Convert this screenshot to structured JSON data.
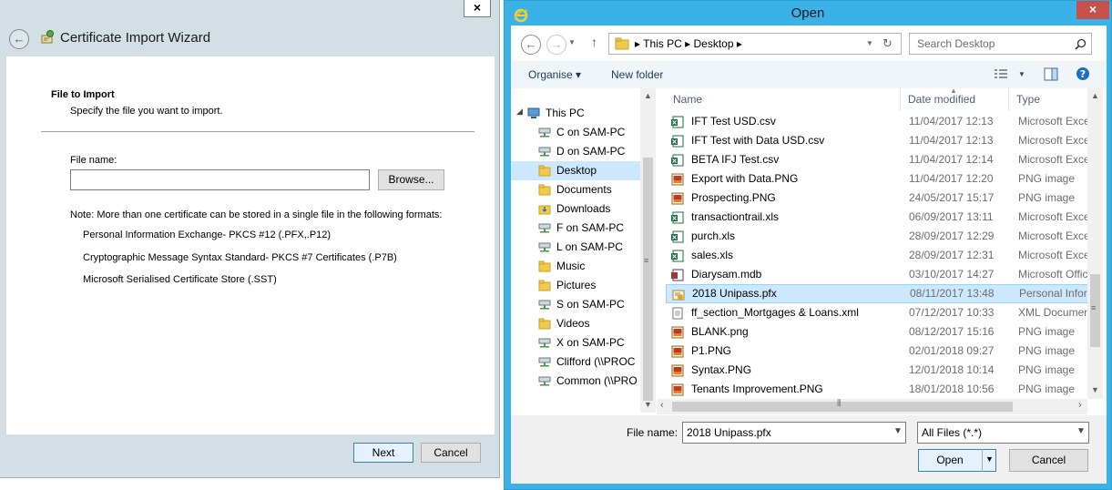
{
  "wizard": {
    "title": "Certificate Import Wizard",
    "close_glyph": "×",
    "back_glyph": "←",
    "heading": "File to Import",
    "subheading": "Specify the file you want to import.",
    "file_name_label": "File name:",
    "file_name_value": "",
    "browse_label": "Browse...",
    "note": "Note:  More than one certificate can be stored in a single file in the following formats:",
    "formats": [
      "Personal Information Exchange- PKCS #12 (.PFX,.P12)",
      "Cryptographic Message Syntax Standard- PKCS #7 Certificates (.P7B)",
      "Microsoft Serialised Certificate Store (.SST)"
    ],
    "next_label": "Next",
    "cancel_label": "Cancel"
  },
  "open": {
    "title": "Open",
    "close_glyph": "×",
    "address": "▸  This PC  ▸  Desktop  ▸",
    "search_placeholder": "Search Desktop",
    "organise_label": "Organise ▾",
    "new_folder_label": "New folder",
    "nav_items": [
      {
        "label": "This PC",
        "icon": "pc-icon",
        "indent": 0
      },
      {
        "label": "C on SAM-PC",
        "icon": "network-drive-icon",
        "indent": 1
      },
      {
        "label": "D on SAM-PC",
        "icon": "network-drive-icon",
        "indent": 1
      },
      {
        "label": "Desktop",
        "icon": "folder-icon",
        "indent": 1,
        "selected": true
      },
      {
        "label": "Documents",
        "icon": "folder-icon",
        "indent": 1
      },
      {
        "label": "Downloads",
        "icon": "download-folder-icon",
        "indent": 1
      },
      {
        "label": "F on SAM-PC",
        "icon": "network-drive-icon",
        "indent": 1
      },
      {
        "label": "L on SAM-PC",
        "icon": "network-drive-icon",
        "indent": 1
      },
      {
        "label": "Music",
        "icon": "folder-icon",
        "indent": 1
      },
      {
        "label": "Pictures",
        "icon": "folder-icon",
        "indent": 1
      },
      {
        "label": "S on SAM-PC",
        "icon": "network-drive-icon",
        "indent": 1
      },
      {
        "label": "Videos",
        "icon": "folder-icon",
        "indent": 1
      },
      {
        "label": "X on SAM-PC",
        "icon": "network-drive-icon",
        "indent": 1
      },
      {
        "label": "Clifford (\\\\PROC",
        "icon": "network-drive-icon",
        "indent": 1
      },
      {
        "label": "Common (\\\\PRO",
        "icon": "network-drive-icon",
        "indent": 1
      }
    ],
    "columns": [
      "Name",
      "Date modified",
      "Type"
    ],
    "files": [
      {
        "name": "IFT Test USD.csv",
        "date": "11/04/2017 12:13",
        "type": "Microsoft Exce",
        "icon": "excel-file-icon"
      },
      {
        "name": "IFT Test with Data USD.csv",
        "date": "11/04/2017 12:13",
        "type": "Microsoft Exce",
        "icon": "excel-file-icon"
      },
      {
        "name": "BETA IFJ Test.csv",
        "date": "11/04/2017 12:14",
        "type": "Microsoft Exce",
        "icon": "excel-file-icon"
      },
      {
        "name": "Export with Data.PNG",
        "date": "11/04/2017 12:20",
        "type": "PNG image",
        "icon": "png-file-icon"
      },
      {
        "name": "Prospecting.PNG",
        "date": "24/05/2017 15:17",
        "type": "PNG image",
        "icon": "png-file-icon"
      },
      {
        "name": "transactiontrail.xls",
        "date": "06/09/2017 13:11",
        "type": "Microsoft Exce",
        "icon": "excel-file-icon"
      },
      {
        "name": "purch.xls",
        "date": "28/09/2017 12:29",
        "type": "Microsoft Exce",
        "icon": "excel-file-icon"
      },
      {
        "name": "sales.xls",
        "date": "28/09/2017 12:31",
        "type": "Microsoft Exce",
        "icon": "excel-file-icon"
      },
      {
        "name": "Diarysam.mdb",
        "date": "03/10/2017 14:27",
        "type": "Microsoft Offic",
        "icon": "access-file-icon"
      },
      {
        "name": "2018 Unipass.pfx",
        "date": "08/11/2017 13:48",
        "type": "Personal Inforr",
        "icon": "certificate-file-icon",
        "selected": true
      },
      {
        "name": "ff_section_Mortgages & Loans.xml",
        "date": "07/12/2017 10:33",
        "type": "XML Documen",
        "icon": "xml-file-icon"
      },
      {
        "name": "BLANK.png",
        "date": "08/12/2017 15:16",
        "type": "PNG image",
        "icon": "png-file-icon"
      },
      {
        "name": "P1.PNG",
        "date": "02/01/2018 09:27",
        "type": "PNG image",
        "icon": "png-file-icon"
      },
      {
        "name": "Syntax.PNG",
        "date": "12/01/2018 10:14",
        "type": "PNG image",
        "icon": "png-file-icon"
      },
      {
        "name": "Tenants Improvement.PNG",
        "date": "18/01/2018 10:56",
        "type": "PNG image",
        "icon": "png-file-icon"
      }
    ],
    "file_name_label": "File name:",
    "file_name_value": "2018 Unipass.pfx",
    "filter_value": "All Files (*.*)",
    "open_label": "Open",
    "cancel_label": "Cancel"
  }
}
